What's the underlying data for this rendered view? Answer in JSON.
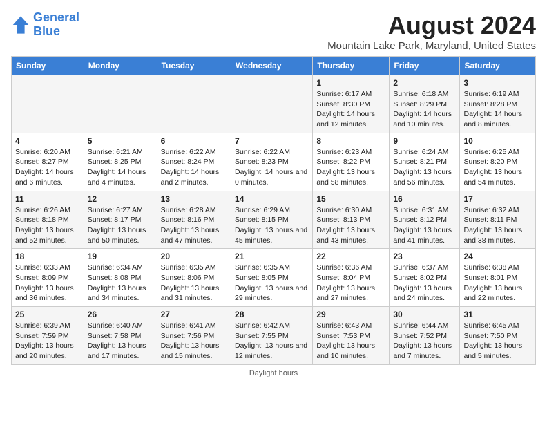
{
  "header": {
    "logo_line1": "General",
    "logo_line2": "Blue",
    "main_title": "August 2024",
    "subtitle": "Mountain Lake Park, Maryland, United States"
  },
  "days_of_week": [
    "Sunday",
    "Monday",
    "Tuesday",
    "Wednesday",
    "Thursday",
    "Friday",
    "Saturday"
  ],
  "weeks": [
    [
      {
        "day": "",
        "content": ""
      },
      {
        "day": "",
        "content": ""
      },
      {
        "day": "",
        "content": ""
      },
      {
        "day": "",
        "content": ""
      },
      {
        "day": "1",
        "content": "Sunrise: 6:17 AM\nSunset: 8:30 PM\nDaylight: 14 hours and 12 minutes."
      },
      {
        "day": "2",
        "content": "Sunrise: 6:18 AM\nSunset: 8:29 PM\nDaylight: 14 hours and 10 minutes."
      },
      {
        "day": "3",
        "content": "Sunrise: 6:19 AM\nSunset: 8:28 PM\nDaylight: 14 hours and 8 minutes."
      }
    ],
    [
      {
        "day": "4",
        "content": "Sunrise: 6:20 AM\nSunset: 8:27 PM\nDaylight: 14 hours and 6 minutes."
      },
      {
        "day": "5",
        "content": "Sunrise: 6:21 AM\nSunset: 8:25 PM\nDaylight: 14 hours and 4 minutes."
      },
      {
        "day": "6",
        "content": "Sunrise: 6:22 AM\nSunset: 8:24 PM\nDaylight: 14 hours and 2 minutes."
      },
      {
        "day": "7",
        "content": "Sunrise: 6:22 AM\nSunset: 8:23 PM\nDaylight: 14 hours and 0 minutes."
      },
      {
        "day": "8",
        "content": "Sunrise: 6:23 AM\nSunset: 8:22 PM\nDaylight: 13 hours and 58 minutes."
      },
      {
        "day": "9",
        "content": "Sunrise: 6:24 AM\nSunset: 8:21 PM\nDaylight: 13 hours and 56 minutes."
      },
      {
        "day": "10",
        "content": "Sunrise: 6:25 AM\nSunset: 8:20 PM\nDaylight: 13 hours and 54 minutes."
      }
    ],
    [
      {
        "day": "11",
        "content": "Sunrise: 6:26 AM\nSunset: 8:18 PM\nDaylight: 13 hours and 52 minutes."
      },
      {
        "day": "12",
        "content": "Sunrise: 6:27 AM\nSunset: 8:17 PM\nDaylight: 13 hours and 50 minutes."
      },
      {
        "day": "13",
        "content": "Sunrise: 6:28 AM\nSunset: 8:16 PM\nDaylight: 13 hours and 47 minutes."
      },
      {
        "day": "14",
        "content": "Sunrise: 6:29 AM\nSunset: 8:15 PM\nDaylight: 13 hours and 45 minutes."
      },
      {
        "day": "15",
        "content": "Sunrise: 6:30 AM\nSunset: 8:13 PM\nDaylight: 13 hours and 43 minutes."
      },
      {
        "day": "16",
        "content": "Sunrise: 6:31 AM\nSunset: 8:12 PM\nDaylight: 13 hours and 41 minutes."
      },
      {
        "day": "17",
        "content": "Sunrise: 6:32 AM\nSunset: 8:11 PM\nDaylight: 13 hours and 38 minutes."
      }
    ],
    [
      {
        "day": "18",
        "content": "Sunrise: 6:33 AM\nSunset: 8:09 PM\nDaylight: 13 hours and 36 minutes."
      },
      {
        "day": "19",
        "content": "Sunrise: 6:34 AM\nSunset: 8:08 PM\nDaylight: 13 hours and 34 minutes."
      },
      {
        "day": "20",
        "content": "Sunrise: 6:35 AM\nSunset: 8:06 PM\nDaylight: 13 hours and 31 minutes."
      },
      {
        "day": "21",
        "content": "Sunrise: 6:35 AM\nSunset: 8:05 PM\nDaylight: 13 hours and 29 minutes."
      },
      {
        "day": "22",
        "content": "Sunrise: 6:36 AM\nSunset: 8:04 PM\nDaylight: 13 hours and 27 minutes."
      },
      {
        "day": "23",
        "content": "Sunrise: 6:37 AM\nSunset: 8:02 PM\nDaylight: 13 hours and 24 minutes."
      },
      {
        "day": "24",
        "content": "Sunrise: 6:38 AM\nSunset: 8:01 PM\nDaylight: 13 hours and 22 minutes."
      }
    ],
    [
      {
        "day": "25",
        "content": "Sunrise: 6:39 AM\nSunset: 7:59 PM\nDaylight: 13 hours and 20 minutes."
      },
      {
        "day": "26",
        "content": "Sunrise: 6:40 AM\nSunset: 7:58 PM\nDaylight: 13 hours and 17 minutes."
      },
      {
        "day": "27",
        "content": "Sunrise: 6:41 AM\nSunset: 7:56 PM\nDaylight: 13 hours and 15 minutes."
      },
      {
        "day": "28",
        "content": "Sunrise: 6:42 AM\nSunset: 7:55 PM\nDaylight: 13 hours and 12 minutes."
      },
      {
        "day": "29",
        "content": "Sunrise: 6:43 AM\nSunset: 7:53 PM\nDaylight: 13 hours and 10 minutes."
      },
      {
        "day": "30",
        "content": "Sunrise: 6:44 AM\nSunset: 7:52 PM\nDaylight: 13 hours and 7 minutes."
      },
      {
        "day": "31",
        "content": "Sunrise: 6:45 AM\nSunset: 7:50 PM\nDaylight: 13 hours and 5 minutes."
      }
    ]
  ],
  "footer": "Daylight hours"
}
